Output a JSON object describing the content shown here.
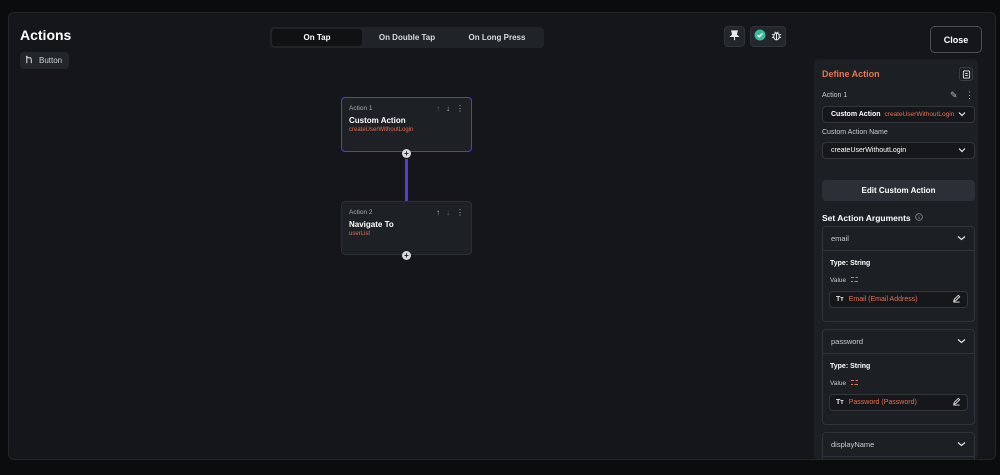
{
  "header": {
    "title": "Actions",
    "widget_chip": {
      "label": "Button",
      "icon": "widget-icon"
    }
  },
  "tabs": [
    {
      "label": "On Tap",
      "active": true
    },
    {
      "label": "On Double Tap",
      "active": false
    },
    {
      "label": "On Long Press",
      "active": false
    }
  ],
  "toolbar": {
    "close_label": "Close",
    "icons": [
      "pin-icon",
      "check-circle-icon",
      "bug-icon"
    ]
  },
  "canvas": {
    "actions": [
      {
        "label": "Action 1",
        "name": "Custom Action",
        "detail": "createUserWithoutLogin",
        "selected": true
      },
      {
        "label": "Action 2",
        "name": "Navigate To",
        "detail": "userList",
        "selected": false
      }
    ],
    "add_symbol": "+"
  },
  "panel": {
    "title": "Define Action",
    "action_label": "Action 1",
    "action_type": {
      "prefix": "Custom Action",
      "value": "createUserWithoutLogin"
    },
    "custom_action_name_label": "Custom Action Name",
    "custom_action_name_value": "createUserWithoutLogin",
    "edit_button": "Edit Custom Action",
    "arguments_title": "Set Action Arguments",
    "arguments": [
      {
        "name": "email",
        "type": "Type: String",
        "value_label": "Value",
        "value": "Email (Email Address)"
      },
      {
        "name": "password",
        "type": "Type: String",
        "value_label": "Value",
        "value": "Password (Password)"
      },
      {
        "name": "displayName"
      }
    ],
    "text_icon_glyph": "Tт"
  },
  "colors": {
    "accent": "#e8754f",
    "value_text": "#e86e4e",
    "selection": "#4b3fe0",
    "background": "#141619"
  }
}
